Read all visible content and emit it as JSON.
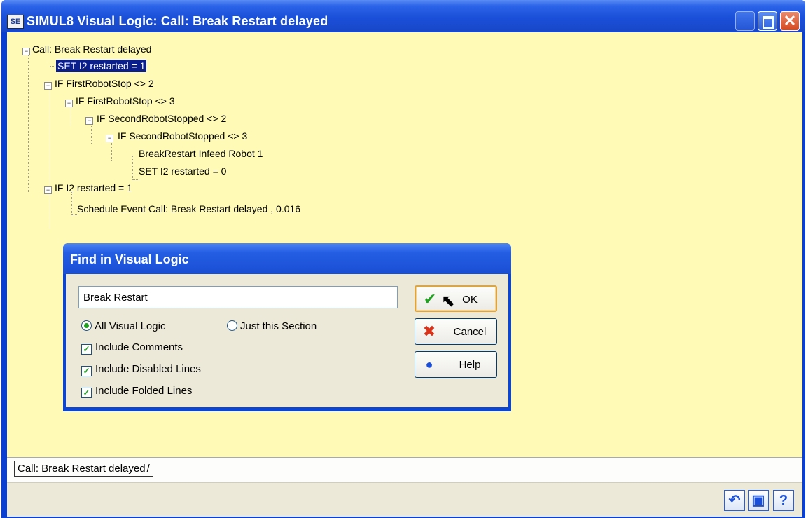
{
  "window": {
    "icon_text": "SE",
    "title": "SIMUL8 Visual Logic: Call: Break Restart delayed"
  },
  "tree": [
    {
      "text": "Call: Break Restart delayed"
    },
    {
      "text": "SET I2 restarted  =  1",
      "selected": true
    },
    {
      "text": "IF FirstRobotStop  <>  2"
    },
    {
      "text": "IF FirstRobotStop  <>  3"
    },
    {
      "text": "IF SecondRobotStopped  <>  2"
    },
    {
      "text": "IF SecondRobotStopped  <>  3"
    },
    {
      "text": "BreakRestart   Infeed Robot 1"
    },
    {
      "text": "SET I2 restarted  =  0"
    },
    {
      "text": "IF I2 restarted  =  1"
    },
    {
      "text": "Schedule Event   Call: Break Restart delayed ,  0.016"
    }
  ],
  "dialog": {
    "title": "Find in Visual Logic",
    "search_value": "Break Restart",
    "radio_all": "All Visual Logic",
    "radio_section": "Just this Section",
    "check_comments": "Include Comments",
    "check_disabled": "Include Disabled Lines",
    "check_folded": "Include Folded Lines",
    "ok_label": "OK",
    "cancel_label": "Cancel",
    "help_label": "Help",
    "selected_scope": "All Visual Logic"
  },
  "tabs": {
    "active": "Call: Break Restart delayed"
  },
  "colors": {
    "logic_background": "#fffbb6",
    "selection": "#0a1e8c",
    "titlebar": "#1a4fd9"
  }
}
